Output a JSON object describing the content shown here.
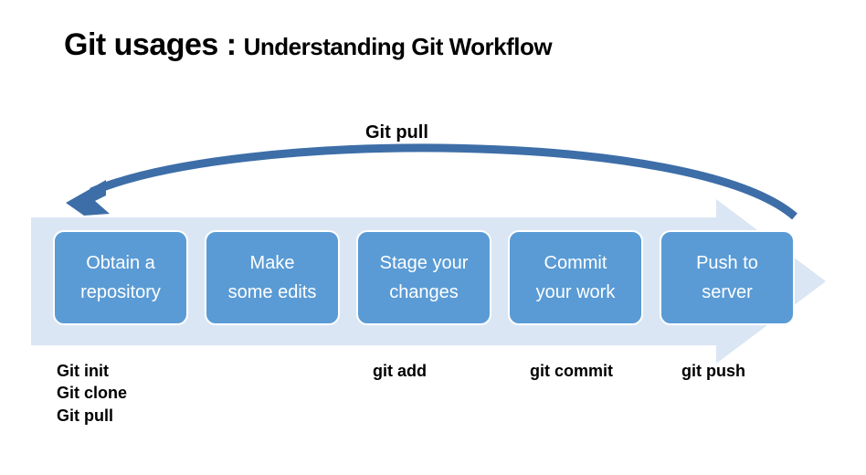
{
  "title": {
    "main": "Git usages :",
    "sub": "Understanding Git Workflow"
  },
  "pull_label": "Git pull",
  "steps": [
    {
      "line1": "Obtain a",
      "line2": "repository"
    },
    {
      "line1": "Make",
      "line2": "some edits"
    },
    {
      "line1": "Stage your",
      "line2": "changes"
    },
    {
      "line1": "Commit",
      "line2": "your work"
    },
    {
      "line1": "Push to",
      "line2": "server"
    }
  ],
  "commands": [
    [
      "Git init",
      "Git clone",
      "Git pull"
    ],
    [],
    [
      "git add"
    ],
    [
      "git commit"
    ],
    [
      "git push"
    ]
  ],
  "colors": {
    "step_bg": "#5a9bd5",
    "arrow_bg": "#dbe6f4",
    "curve": "#3d6ea8"
  }
}
